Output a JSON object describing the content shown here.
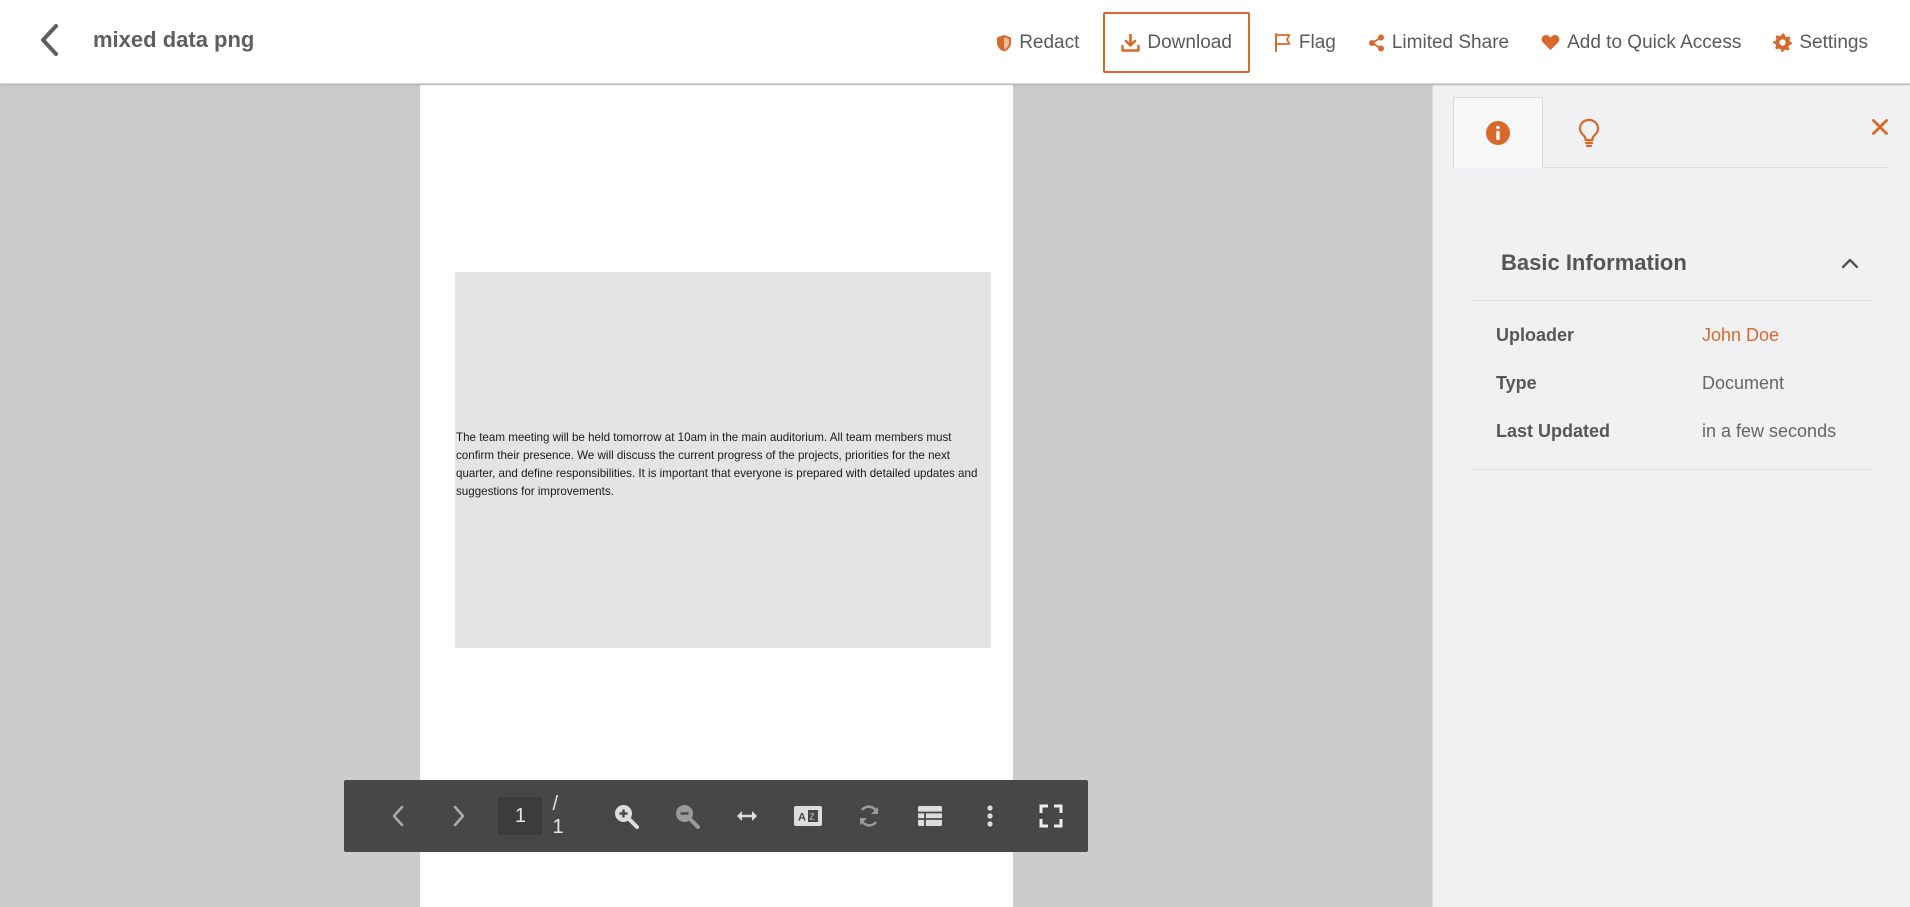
{
  "header": {
    "title": "mixed data png",
    "actions": {
      "redact": "Redact",
      "download": "Download",
      "flag": "Flag",
      "limited_share": "Limited Share",
      "quick_access": "Add to Quick Access",
      "settings": "Settings"
    }
  },
  "document": {
    "text": "The team meeting will be held tomorrow at 10am in the main auditorium. All team members must confirm their presence. We will discuss the current progress of the projects, priorities for the next quarter, and define responsibilities. It is important that everyone is prepared with detailed updates and suggestions for improvements."
  },
  "toolbar": {
    "current_page": "1",
    "total_pages": "/ 1"
  },
  "panel": {
    "section_title": "Basic Information",
    "rows": [
      {
        "label": "Uploader",
        "value": "John Doe"
      },
      {
        "label": "Type",
        "value": "Document"
      },
      {
        "label": "Last Updated",
        "value": "in a few seconds"
      }
    ]
  },
  "colors": {
    "accent": "#d9692a",
    "toolbar_bg": "#474747",
    "viewer_bg": "#cccccc",
    "panel_bg": "#f1f1f3"
  }
}
